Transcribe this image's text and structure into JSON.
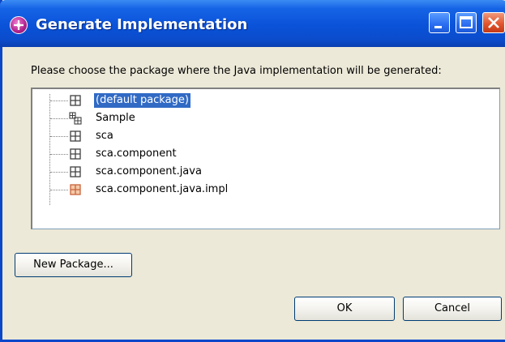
{
  "window": {
    "title": "Generate Implementation"
  },
  "dialog": {
    "prompt": "Please choose the package where the Java implementation will be generated:"
  },
  "tree": {
    "items": [
      {
        "label": "(default package)",
        "icon": "package-icon",
        "selected": true
      },
      {
        "label": "Sample",
        "icon": "package-hierarchy-icon",
        "selected": false
      },
      {
        "label": "sca",
        "icon": "package-icon",
        "selected": false
      },
      {
        "label": "sca.component",
        "icon": "package-icon",
        "selected": false
      },
      {
        "label": "sca.component.java",
        "icon": "package-icon",
        "selected": false
      },
      {
        "label": "sca.component.java.impl",
        "icon": "package-icon-orange",
        "selected": false
      }
    ]
  },
  "buttons": {
    "new_package": "New Package...",
    "ok": "OK",
    "cancel": "Cancel"
  },
  "colors": {
    "titlebar": "#0a52d8",
    "selection": "#316ac5",
    "dialog_bg": "#ece9d8",
    "impl_icon": "#c8643c"
  }
}
